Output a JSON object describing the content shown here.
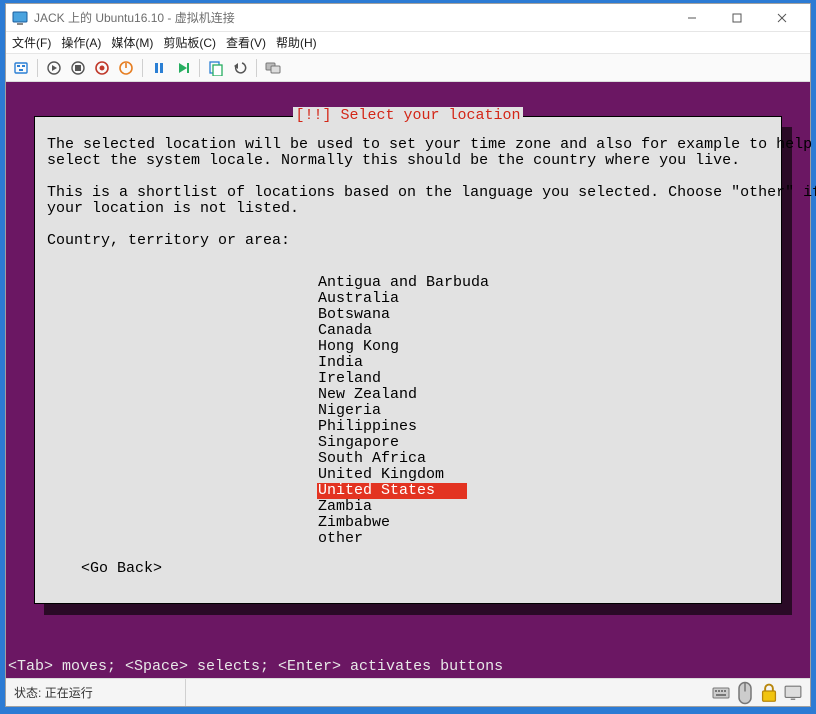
{
  "window": {
    "title": "JACK 上的 Ubuntu16.10 - 虚拟机连接"
  },
  "menu": {
    "file": "文件(F)",
    "action": "操作(A)",
    "media": "媒体(M)",
    "clip": "剪贴板(C)",
    "view": "查看(V)",
    "help": "帮助(H)"
  },
  "installer": {
    "title": "[!!] Select your location",
    "para1_l1": "The selected location will be used to set your time zone and also for example to help",
    "para1_l2": "select the system locale. Normally this should be the country where you live.",
    "para2_l1": "This is a shortlist of locations based on the language you selected. Choose \"other\" if",
    "para2_l2": "your location is not listed.",
    "prompt": "Country, territory or area:",
    "locations": [
      "Antigua and Barbuda",
      "Australia",
      "Botswana",
      "Canada",
      "Hong Kong",
      "India",
      "Ireland",
      "New Zealand",
      "Nigeria",
      "Philippines",
      "Singapore",
      "South Africa",
      "United Kingdom",
      "United States",
      "Zambia",
      "Zimbabwe",
      "other"
    ],
    "selected_index": 13,
    "go_back": "<Go Back>",
    "hint": "<Tab> moves; <Space> selects; <Enter> activates buttons"
  },
  "status": {
    "label": "状态:",
    "value": "正在运行"
  }
}
